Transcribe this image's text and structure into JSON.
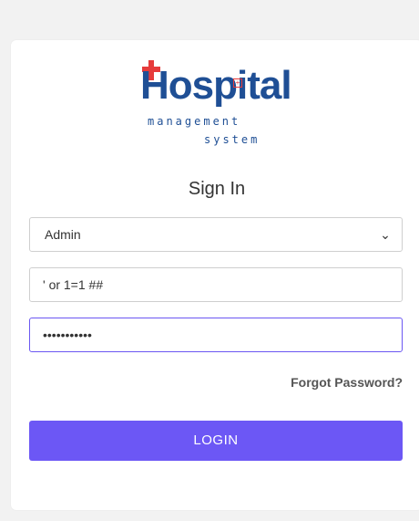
{
  "logo": {
    "word": "Hospital",
    "sub1": "management",
    "sub2": "system"
  },
  "title": "Sign In",
  "role_select": {
    "selected": "Admin"
  },
  "username": {
    "value": "' or 1=1 ##"
  },
  "password": {
    "value": "•••••••••••"
  },
  "links": {
    "forgot": "Forgot Password?"
  },
  "buttons": {
    "login": "LOGIN"
  },
  "colors": {
    "accent": "#6c57f5",
    "logo_blue": "#1f4f95",
    "logo_red": "#e63b3b"
  }
}
